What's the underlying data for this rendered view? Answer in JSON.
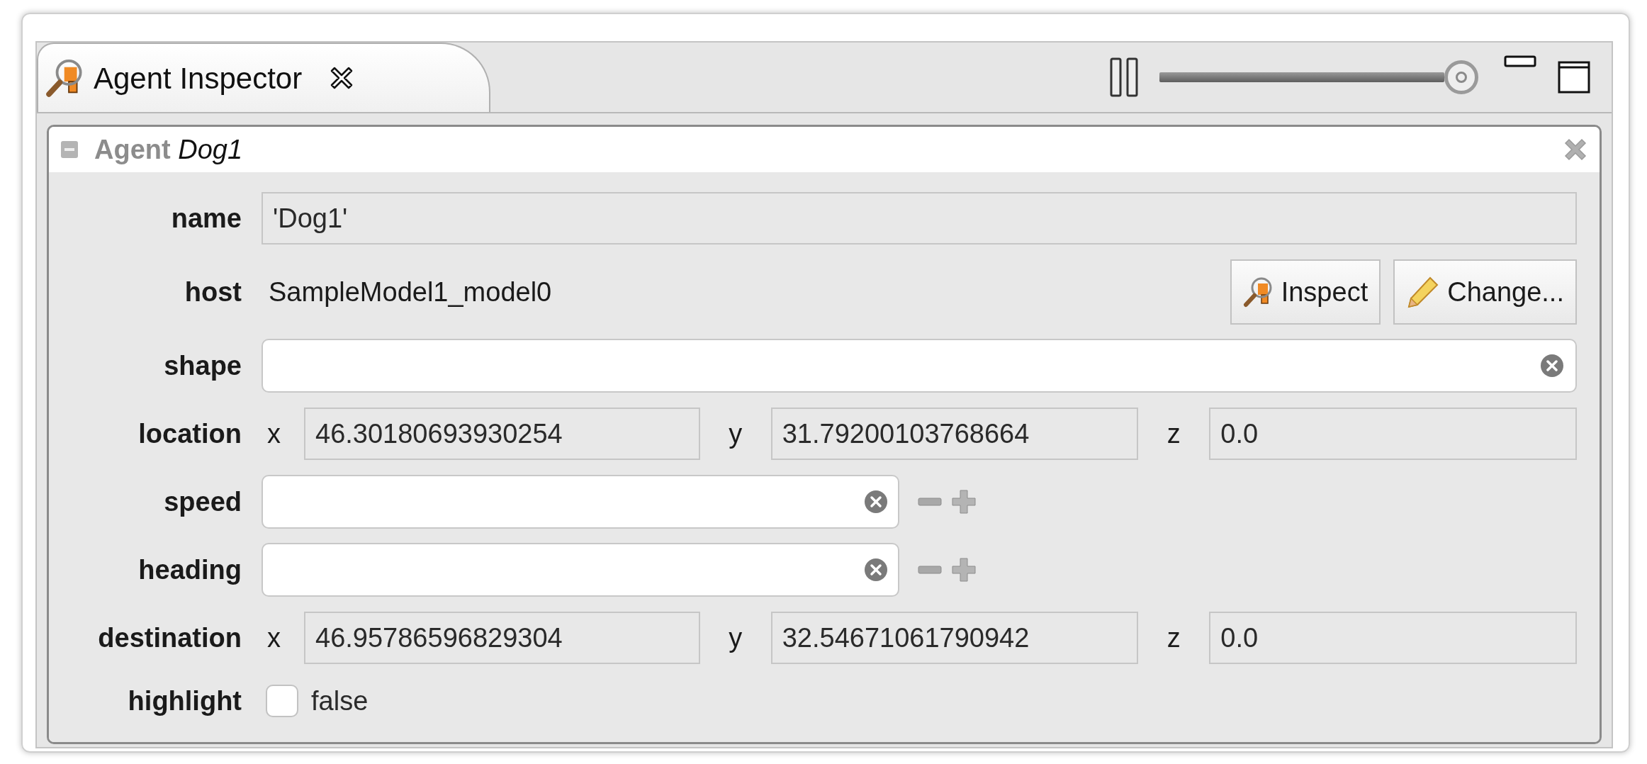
{
  "tab": {
    "title": "Agent Inspector"
  },
  "toolbar": {
    "slider": {
      "level": 1.0
    }
  },
  "panel": {
    "title_prefix": "Agent",
    "title_name": "Dog1",
    "expanded": true
  },
  "fields": [
    {
      "kind": "readonly",
      "label": "name",
      "value": "'Dog1'"
    },
    {
      "kind": "text_buttons",
      "label": "host",
      "value": "SampleModel1_model0",
      "buttons": [
        {
          "kind": "inspect",
          "label": "Inspect"
        },
        {
          "kind": "edit",
          "label": "Change..."
        }
      ]
    },
    {
      "kind": "clearable",
      "label": "shape"
    },
    {
      "kind": "xyz",
      "label": "location",
      "coords": [
        {
          "axis": "x",
          "value": "46.30180693930254"
        },
        {
          "axis": "y",
          "value": "31.79200103768664"
        },
        {
          "axis": "z",
          "value": "0.0"
        }
      ]
    },
    {
      "kind": "stepper",
      "label": "speed"
    },
    {
      "kind": "stepper",
      "label": "heading"
    },
    {
      "kind": "xyz",
      "label": "destination",
      "coords": [
        {
          "axis": "x",
          "value": "46.95786596829304"
        },
        {
          "axis": "y",
          "value": "32.54671061790942"
        },
        {
          "axis": "z",
          "value": "0.0"
        }
      ]
    },
    {
      "kind": "checkbox",
      "label": "highlight",
      "checked": false,
      "value": "false"
    }
  ]
}
